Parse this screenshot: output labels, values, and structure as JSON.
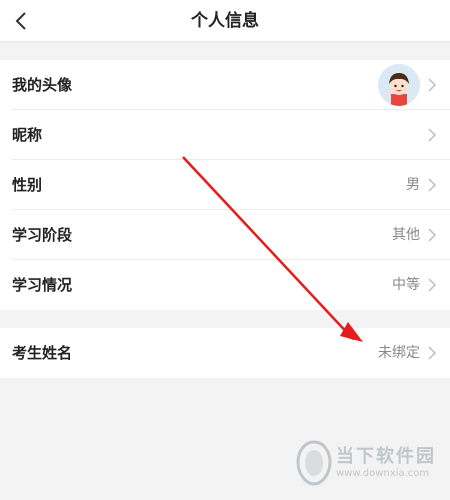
{
  "nav": {
    "title": "个人信息",
    "back_icon": "chevron-left-icon"
  },
  "group1": {
    "rows": [
      {
        "label": "我的头像",
        "value": "",
        "type": "avatar"
      },
      {
        "label": "昵称",
        "value": ""
      },
      {
        "label": "性别",
        "value": "男"
      },
      {
        "label": "学习阶段",
        "value": "其他"
      },
      {
        "label": "学习情况",
        "value": "中等"
      }
    ]
  },
  "group2": {
    "rows": [
      {
        "label": "考生姓名",
        "value": "未绑定"
      }
    ]
  },
  "annotation": {
    "arrow_color": "#e51c1c"
  },
  "watermark": {
    "name": "当下软件园",
    "url": "www.downxia.com"
  },
  "colors": {
    "background": "#f3f3f3",
    "card": "#ffffff",
    "value_text": "#888888"
  }
}
